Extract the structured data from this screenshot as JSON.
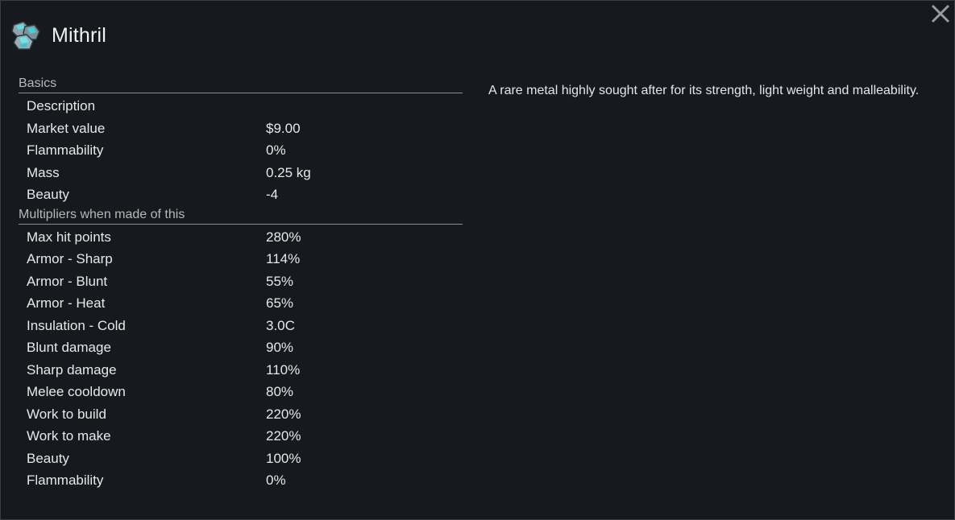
{
  "window": {
    "title": "Mithril",
    "item_icon": "mithril-chunk-icon",
    "close_icon": "close-icon"
  },
  "sections": {
    "basics": {
      "header": "Basics",
      "rows": [
        {
          "label": "Description",
          "value": ""
        },
        {
          "label": "Market value",
          "value": "$9.00"
        },
        {
          "label": "Flammability",
          "value": "0%"
        },
        {
          "label": "Mass",
          "value": "0.25 kg"
        },
        {
          "label": "Beauty",
          "value": "-4"
        }
      ]
    },
    "multipliers": {
      "header": "Multipliers when made of this",
      "rows": [
        {
          "label": "Max hit points",
          "value": "280%"
        },
        {
          "label": "Armor - Sharp",
          "value": "114%"
        },
        {
          "label": "Armor - Blunt",
          "value": "55%"
        },
        {
          "label": "Armor - Heat",
          "value": "65%"
        },
        {
          "label": "Insulation - Cold",
          "value": "3.0C"
        },
        {
          "label": "Blunt damage",
          "value": "90%"
        },
        {
          "label": "Sharp damage",
          "value": "110%"
        },
        {
          "label": "Melee cooldown",
          "value": "80%"
        },
        {
          "label": "Work to build",
          "value": "220%"
        },
        {
          "label": "Work to make",
          "value": "220%"
        },
        {
          "label": "Beauty",
          "value": "100%"
        },
        {
          "label": "Flammability",
          "value": "0%"
        }
      ]
    }
  },
  "description": "A rare metal highly sought after for its strength, light weight and malleability.",
  "colors": {
    "background": "#16191e",
    "text": "#e6e6e6",
    "section_header": "#b8b8b8",
    "divider": "#8c8c8c",
    "mithril_accent": "#4fd3d8"
  }
}
